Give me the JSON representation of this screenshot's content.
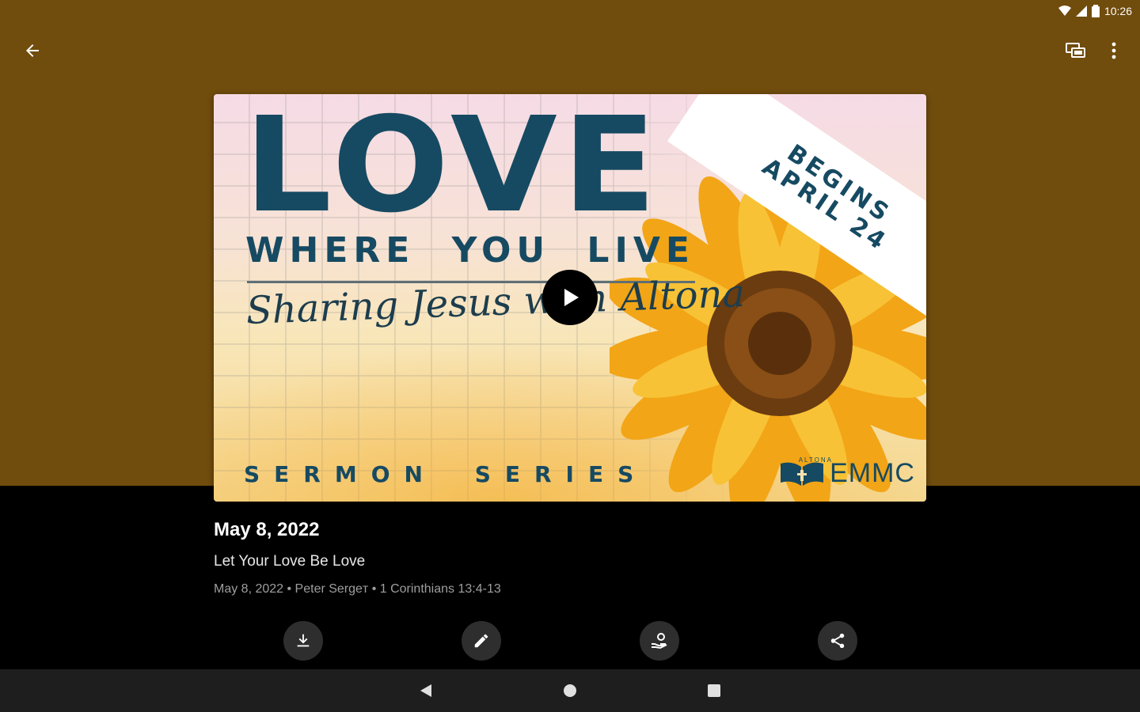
{
  "status_bar": {
    "time": "10:26"
  },
  "app_bar": {
    "back_icon": "arrow-back-icon",
    "cast_icon": "cast-icon",
    "more_icon": "more-vert-icon"
  },
  "artwork": {
    "headline": "LOVE",
    "subheadline": "WHERE YOU LIVE",
    "script": "Sharing Jesus with Altona",
    "banner_line1": "BEGINS",
    "banner_line2": "APRIL 24",
    "footer": "SERMON SERIES",
    "logo_small": "ALTONA",
    "logo": "EMMC"
  },
  "sermon": {
    "title": "May 8, 2022",
    "subtitle": "Let Your Love Be Love",
    "meta": "May 8, 2022 • Peter Sergeт • 1 Corinthians 13:4-13"
  },
  "actions": [
    "download-icon",
    "edit-icon",
    "give-icon",
    "share-icon"
  ],
  "colors": {
    "top_background": "#704c0d",
    "accent_text": "#164a62"
  }
}
